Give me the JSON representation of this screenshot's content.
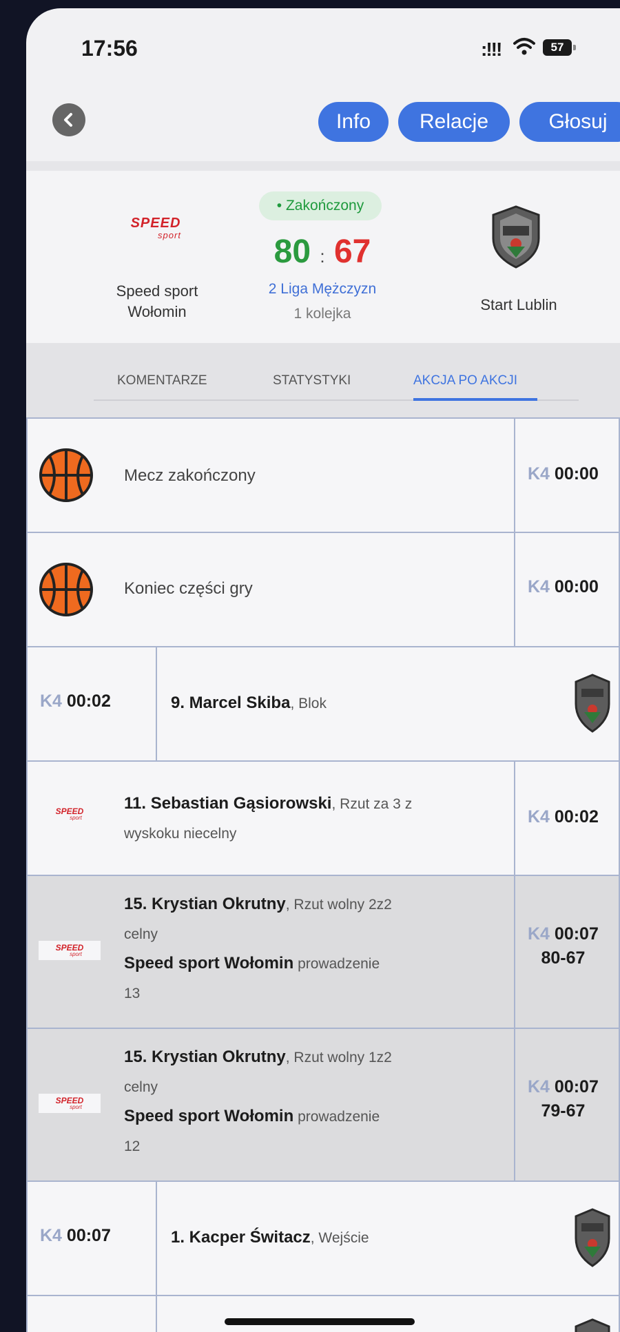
{
  "status_bar": {
    "time": "17:56",
    "signal": ":!!!",
    "battery": "57"
  },
  "nav": {
    "info": "Info",
    "relacje": "Relacje",
    "glosuj": "Głosuj"
  },
  "match": {
    "status": "• Zakończony",
    "home_logo_main": "SPEED",
    "home_logo_sub": "sport",
    "home_name_line1": "Speed sport",
    "home_name_line2": "Wołomin",
    "home_score": "80",
    "separator": ":",
    "away_score": "67",
    "league": "2 Liga Mężczyzn",
    "round": "1 kolejka",
    "away_name": "Start  Lublin",
    "colors": {
      "win": "#2b9a3f",
      "loss": "#e0312f",
      "accent": "#3f74e0"
    }
  },
  "tabs": {
    "komentarze": "KOMENTARZE",
    "statystyki": "STATYSTYKI",
    "akcja": "AKCJA PO AKCJI"
  },
  "feed": [
    {
      "icon": "basketball-icon",
      "text": "Mecz zakończony",
      "quarter": "K4",
      "time": "00:00"
    },
    {
      "icon": "basketball-icon",
      "text": "Koniec części gry",
      "quarter": "K4",
      "time": "00:00"
    },
    {
      "quarter": "K4",
      "time": "00:02",
      "player": "9. Marcel Skiba",
      "action": ", Blok"
    },
    {
      "player": "11. Sebastian Gąsiorowski",
      "action": ",  Rzut za 3 z",
      "action2": "wyskoku niecelny",
      "quarter": "K4",
      "time": "00:02"
    },
    {
      "player": "15. Krystian Okrutny",
      "action": ", Rzut wolny 2z2",
      "action2": "celny",
      "lead_team": "Speed sport Wołomin",
      "lead_text": " prowadzenie",
      "lead_value": "13",
      "quarter": "K4",
      "time": "00:07",
      "score": "80-67"
    },
    {
      "player": "15. Krystian Okrutny",
      "action": ", Rzut wolny 1z2",
      "action2": "celny",
      "lead_team": "Speed sport Wołomin",
      "lead_text": " prowadzenie",
      "lead_value": "12",
      "quarter": "K4",
      "time": "00:07",
      "score": "79-67"
    },
    {
      "quarter": "K4",
      "time": "00:07",
      "player": "1. Kacper Świtacz",
      "action": ",  Wejście"
    }
  ]
}
